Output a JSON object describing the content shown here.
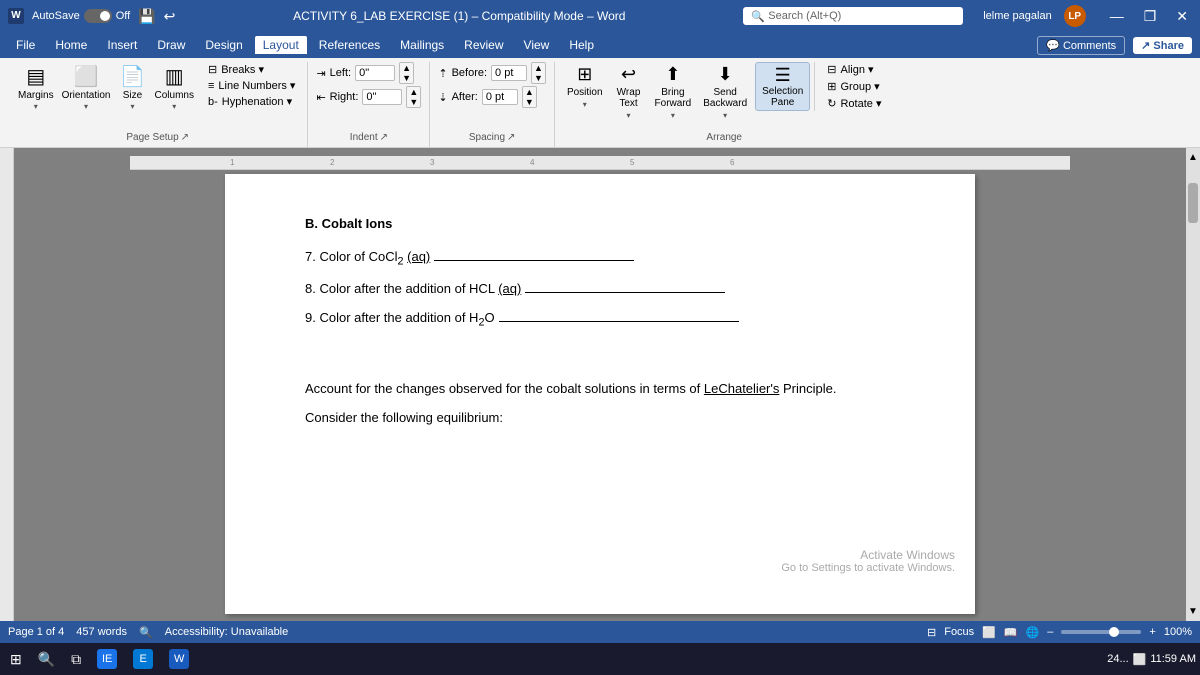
{
  "titlebar": {
    "autosave_label": "AutoSave",
    "autosave_state": "Off",
    "doc_title": "ACTIVITY 6_LAB EXERCISE (1) – Compatibility Mode – Word",
    "search_placeholder": "Search (Alt+Q)",
    "user_name": "lelme pagalan",
    "user_initials": "LP",
    "minimize_icon": "—",
    "restore_icon": "❐",
    "close_icon": "✕"
  },
  "menubar": {
    "items": [
      "File",
      "Home",
      "Insert",
      "Draw",
      "Design",
      "Layout",
      "References",
      "Mailings",
      "Review",
      "View",
      "Help"
    ],
    "active": "Layout",
    "comments_label": "Comments",
    "share_label": "Share"
  },
  "ribbon": {
    "groups": {
      "page_setup": {
        "label": "Page Setup",
        "buttons": [
          {
            "label": "Margins",
            "icon": "▤"
          },
          {
            "label": "Orientation",
            "icon": "⬜"
          },
          {
            "label": "Size",
            "icon": "📄"
          },
          {
            "label": "Columns",
            "icon": "▥"
          }
        ],
        "small_buttons": [
          {
            "label": "Breaks ▾"
          },
          {
            "label": "Line Numbers ▾"
          },
          {
            "label": "Hyphenation ▾"
          }
        ]
      },
      "indent": {
        "label": "Indent",
        "left_label": "Left:",
        "left_value": "0\"",
        "right_label": "Right:",
        "right_value": "0\""
      },
      "spacing": {
        "label": "Spacing",
        "before_label": "Before:",
        "before_value": "0 pt",
        "after_label": "After:",
        "after_value": "0 pt"
      },
      "arrange": {
        "label": "Arrange",
        "position_label": "Position",
        "wrap_label": "Wrap\nText",
        "bring_label": "Bring\nForward",
        "send_label": "Send\nBackward",
        "selection_pane_label": "Selection\nPane",
        "align_label": "Align ▾",
        "group_label": "Group ▾",
        "rotate_label": "Rotate ▾"
      }
    }
  },
  "document": {
    "section_b_heading": "B.  Cobalt Ions",
    "line7": "7. Color of CoCl₂ (aq)",
    "line8": "8. Color after the addition of HCL (aq)",
    "line9": "9. Color after the addition of H₂O",
    "paragraph": "Account for the changes observed for the cobalt solutions in terms of LeChatelier's Principle.",
    "consider": "Consider the following equilibrium:"
  },
  "statusbar": {
    "page_info": "Page 1 of 4",
    "words": "457 words",
    "accessibility": "Accessibility: Unavailable",
    "focus_label": "Focus",
    "zoom_percent": "100%"
  },
  "taskbar": {
    "time": "11:59 AM",
    "notifications_text": "24..."
  }
}
